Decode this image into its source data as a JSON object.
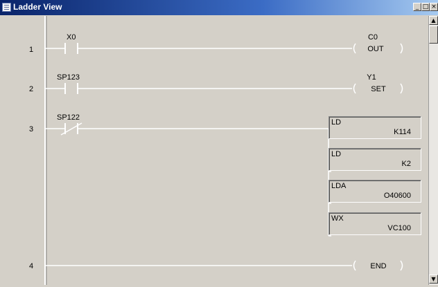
{
  "window": {
    "title": "Ladder View",
    "buttons": {
      "minimize": "_",
      "restore": "□",
      "close": "×"
    }
  },
  "scrollbar": {
    "up": "▲",
    "down": "▼"
  },
  "rungs": [
    {
      "number": "1",
      "contact": {
        "label": "X0",
        "type": "normally-open"
      },
      "coil": {
        "address": "C0",
        "instruction": "OUT"
      }
    },
    {
      "number": "2",
      "contact": {
        "label": "SP123",
        "type": "normally-open"
      },
      "coil": {
        "address": "Y1",
        "instruction": "SET"
      }
    },
    {
      "number": "3",
      "contact": {
        "label": "SP122",
        "type": "normally-closed"
      },
      "boxes": [
        {
          "op": "LD",
          "arg": "K114"
        },
        {
          "op": "LD",
          "arg": "K2"
        },
        {
          "op": "LDA",
          "arg": "O40600"
        },
        {
          "op": "WX",
          "arg": "VC100"
        }
      ]
    },
    {
      "number": "4",
      "coil": {
        "address": "",
        "instruction": "END"
      }
    }
  ],
  "colors": {
    "rail": "#ffffff",
    "background": "#d4d0c8",
    "title_bar": "#0a246a"
  }
}
